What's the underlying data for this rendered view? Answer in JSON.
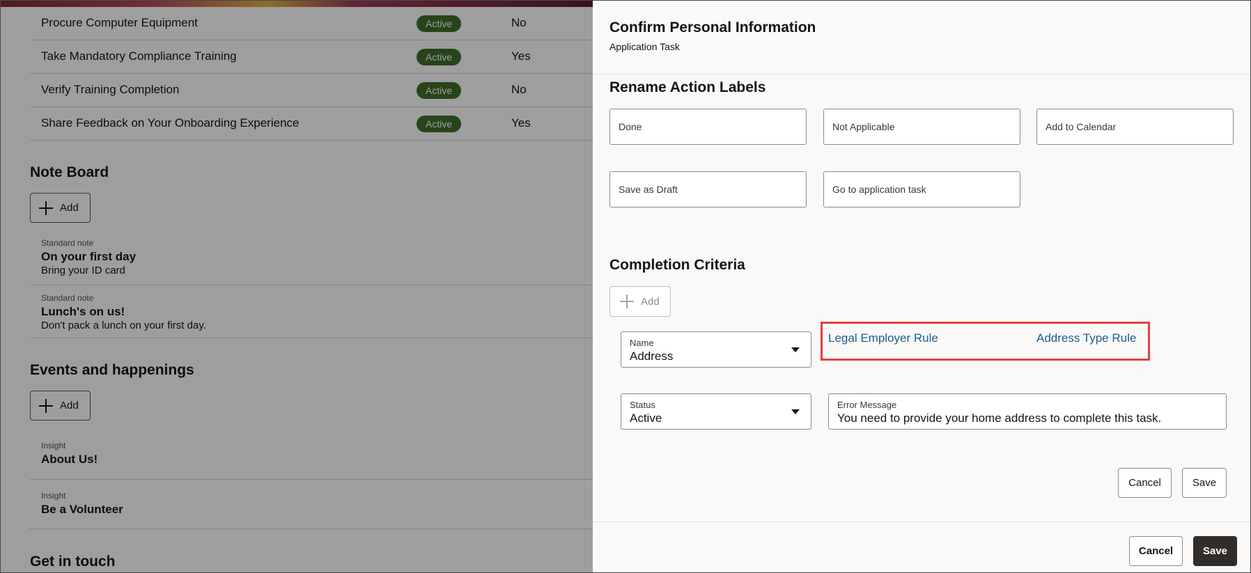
{
  "background": {
    "tasks": [
      {
        "name": "Procure Computer Equipment",
        "status": "Active",
        "required": "No"
      },
      {
        "name": "Take Mandatory Compliance Training",
        "status": "Active",
        "required": "Yes"
      },
      {
        "name": "Verify Training Completion",
        "status": "Active",
        "required": "No"
      },
      {
        "name": "Share Feedback on Your Onboarding Experience",
        "status": "Active",
        "required": "Yes"
      }
    ],
    "note_board": {
      "title": "Note Board",
      "add_label": "Add",
      "notes": [
        {
          "type": "Standard note",
          "title": "On your first day",
          "body": "Bring your ID card"
        },
        {
          "type": "Standard note",
          "title": "Lunch's on us!",
          "body": "Don't pack a lunch on your first day."
        }
      ]
    },
    "events": {
      "title": "Events and happenings",
      "add_label": "Add",
      "insights": [
        {
          "type": "Insight",
          "title": "About Us!"
        },
        {
          "type": "Insight",
          "title": "Be a Volunteer"
        }
      ]
    },
    "get_in_touch": "Get in touch"
  },
  "drawer": {
    "title": "Confirm Personal Information",
    "subtitle": "Application Task",
    "rename_section": {
      "title": "Rename Action Labels",
      "labels": [
        "Done",
        "Not Applicable",
        "Add to Calendar",
        "Save as Draft",
        "Go to application task"
      ]
    },
    "completion": {
      "title": "Completion Criteria",
      "add_label": "Add",
      "name_label": "Name",
      "name_value": "Address",
      "rules": [
        "Legal Employer Rule",
        "Address Type Rule"
      ],
      "status_label": "Status",
      "status_value": "Active",
      "error_label": "Error Message",
      "error_value": "You need to provide your home address to complete this task.",
      "cancel": "Cancel",
      "save": "Save"
    },
    "footer": {
      "cancel": "Cancel",
      "save": "Save"
    }
  },
  "colors": {
    "active_badge": "#3f6f2a",
    "link": "#1a5e8a",
    "highlight": "#e04040",
    "primary_button": "#312d2a"
  }
}
